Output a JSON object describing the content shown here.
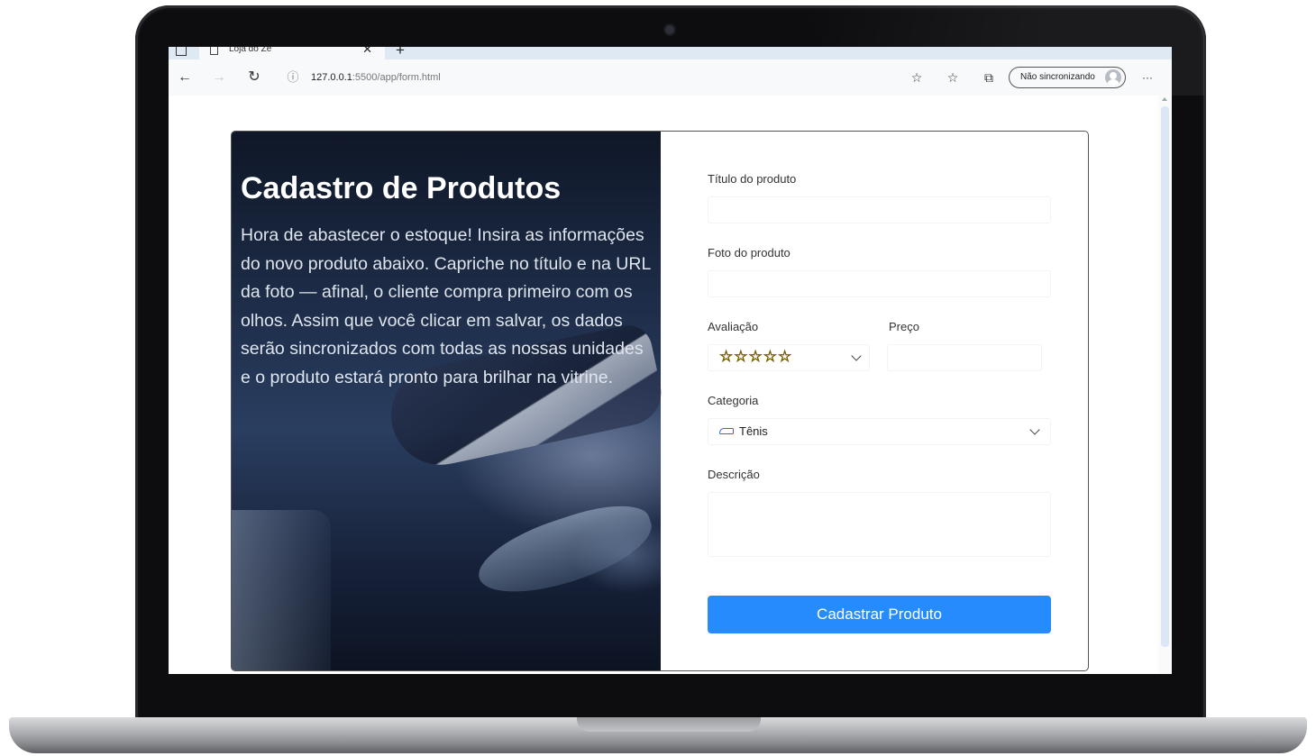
{
  "browser": {
    "tab_title": "Loja do Zé",
    "url_host": "127.0.0.1",
    "url_rest": ":5500/app/form.html",
    "sync_label": "Não sincronizando",
    "more_label": "···"
  },
  "hero": {
    "title": "Cadastro de Produtos",
    "text": "Hora de abastecer o estoque! Insira as informações do novo produto abaixo. Capriche no título e na URL da foto — afinal, o cliente compra primeiro com os olhos. Assim que você clicar em salvar, os dados serão sincronizados com todas as nossas unidades e o produto estará pronto para brilhar na vitrine."
  },
  "form": {
    "title_label": "Título do produto",
    "title_value": "",
    "photo_label": "Foto do produto",
    "photo_value": "",
    "rating_label": "Avaliação",
    "rating_value": "☆☆☆☆☆",
    "price_label": "Preço",
    "price_value": "",
    "category_label": "Categoria",
    "category_value": "Tênis",
    "description_label": "Descrição",
    "description_value": "",
    "submit_label": "Cadastrar Produto"
  },
  "colors": {
    "accent": "#268bfd",
    "star": "#f3c623"
  }
}
